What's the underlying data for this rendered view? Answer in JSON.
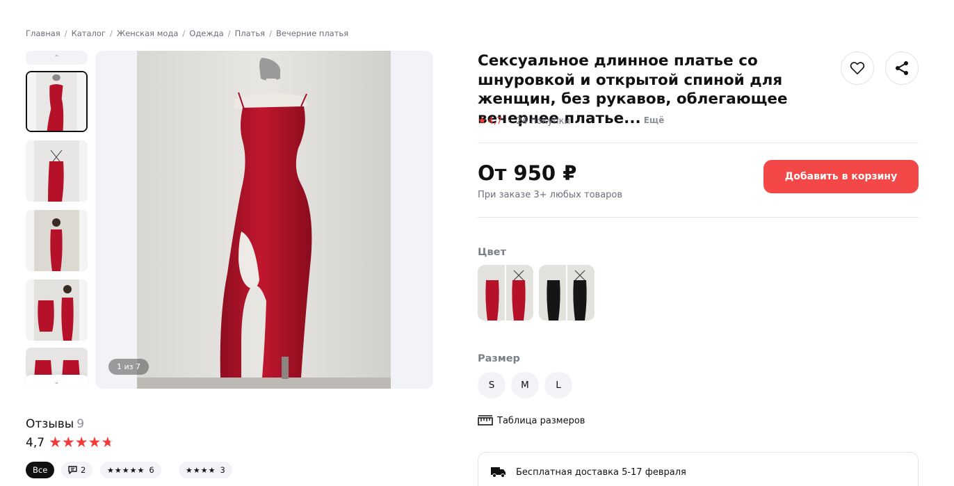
{
  "breadcrumb": [
    "Главная",
    "Каталог",
    "Женская мода",
    "Одежда",
    "Платья",
    "Вечерние платья"
  ],
  "gallery": {
    "counter": "1 из 7",
    "thumb_count": 5
  },
  "product": {
    "title": "Сексуальное длинное платье со шнуровкой и открытой спиной для женщин, без рукавов, облегающее вечернее платье...",
    "more_label": "Ещё",
    "rating": "4,7",
    "purchases": "24 покупки",
    "price": "От 950 ₽",
    "price_note": "При заказе 3+ любых товаров",
    "add_to_cart": "Добавить в корзину"
  },
  "colors": {
    "label": "Цвет",
    "options": [
      "red",
      "black"
    ]
  },
  "sizes": {
    "label": "Размер",
    "options": [
      "S",
      "M",
      "L"
    ],
    "table_label": "Таблица размеров"
  },
  "delivery": {
    "text": "Бесплатная доставка 5-17 февраля"
  },
  "reviews": {
    "title": "Отзывы",
    "count": "9",
    "rating": "4,7",
    "filters": [
      {
        "label": "Все"
      },
      {
        "label": "2",
        "icon": "comment-icon"
      },
      {
        "label": "6",
        "stars": 5
      },
      {
        "label": "3",
        "stars": 4
      }
    ]
  },
  "colors_hex": {
    "accent": "#f44848",
    "star": "#f23b3b",
    "dress_red": "#b5122a"
  }
}
